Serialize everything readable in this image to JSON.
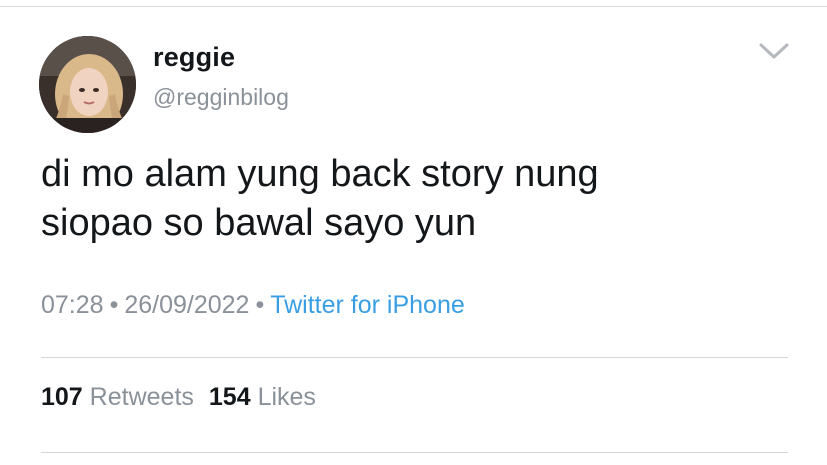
{
  "author": {
    "display_name": "reggie",
    "handle": "@regginbilog"
  },
  "tweet": {
    "lines": [
      "di mo alam yung back story nung",
      "siopao so bawal sayo yun"
    ]
  },
  "meta": {
    "time": "07:28",
    "separator": "•",
    "date": "26/09/2022",
    "source": "Twitter for iPhone"
  },
  "stats": {
    "retweets_count": "107",
    "retweets_label": "Retweets",
    "likes_count": "154",
    "likes_label": "Likes"
  },
  "icons": {
    "menu": "chevron-down-icon",
    "avatar": "avatar"
  },
  "colors": {
    "text": "#14171a",
    "muted": "#8a9199",
    "link": "#3a9ee4",
    "divider": "#d6d6d6"
  }
}
